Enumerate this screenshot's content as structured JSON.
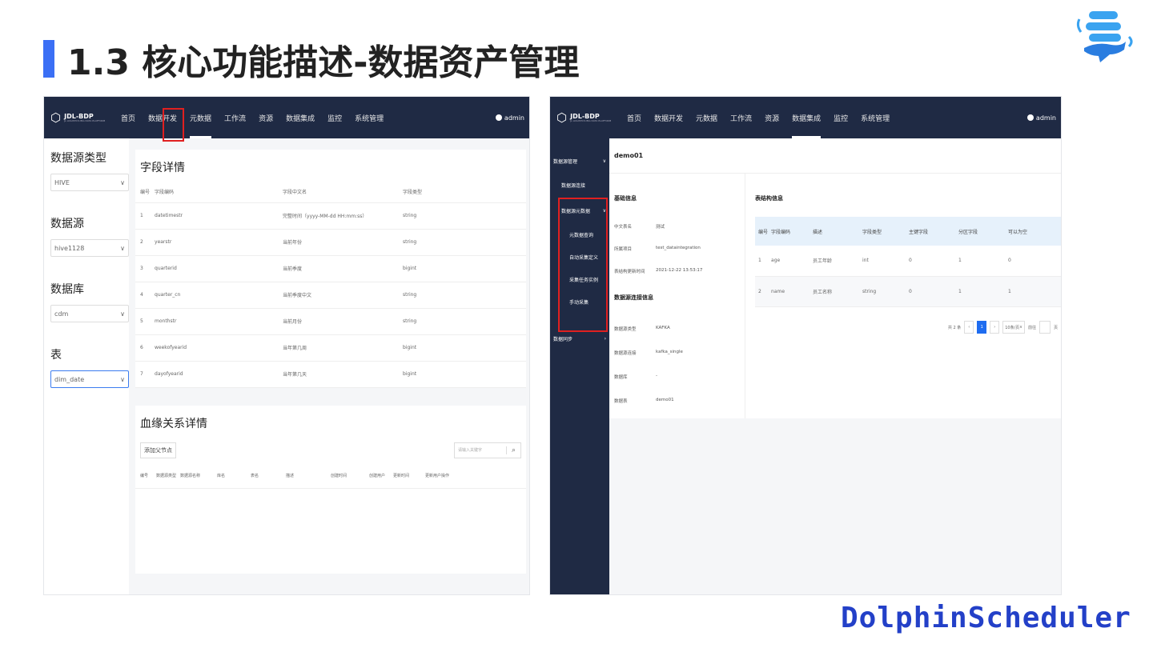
{
  "slide": {
    "title": "1.3 核心功能描述-数据资产管理",
    "brand": "DolphinScheduler",
    "accent_color": "#3b6ff5",
    "brand_color": "#2340c8"
  },
  "left_screen": {
    "logo": {
      "name": "JDL-BDP",
      "sub": "JL LOGISTICS BIG DATA PLATFORM"
    },
    "nav": [
      "首页",
      "数据开发",
      "元数据",
      "工作流",
      "资源",
      "数据集成",
      "监控",
      "系统管理"
    ],
    "active_nav": "元数据",
    "user": "admin",
    "filters": [
      {
        "label": "数据源类型",
        "value": "HIVE"
      },
      {
        "label": "数据源",
        "value": "hive1128"
      },
      {
        "label": "数据库",
        "value": "cdm"
      },
      {
        "label": "表",
        "value": "dim_date"
      }
    ],
    "field_detail": {
      "title": "字段详情",
      "columns": [
        "编号",
        "字段编码",
        "字段中文名",
        "字段类型"
      ],
      "rows": [
        [
          "1",
          "datetimestr",
          "完整时间（yyyy-MM-dd HH:mm:ss）",
          "string"
        ],
        [
          "2",
          "yearstr",
          "当前年份",
          "string"
        ],
        [
          "3",
          "quarterid",
          "当前季度",
          "bigint"
        ],
        [
          "4",
          "quarter_cn",
          "当前季度中文",
          "string"
        ],
        [
          "5",
          "monthstr",
          "当前月份",
          "string"
        ],
        [
          "6",
          "weekofyearid",
          "当年第几周",
          "bigint"
        ],
        [
          "7",
          "dayofyearid",
          "当年第几天",
          "bigint"
        ]
      ]
    },
    "lineage": {
      "title": "血缘关系详情",
      "add_button": "添加父节点",
      "search_placeholder": "请输入关键字",
      "columns": [
        "编号",
        "数据源类型",
        "数据源名称",
        "库名",
        "表名",
        "描述",
        "创建时间",
        "创建用户",
        "更新时间",
        "更新用户",
        "操作"
      ]
    }
  },
  "right_screen": {
    "logo": {
      "name": "JDL-BDP",
      "sub": "JL LOGISTICS BIG DATA PLATFORM"
    },
    "nav": [
      "首页",
      "数据开发",
      "元数据",
      "工作流",
      "资源",
      "数据集成",
      "监控",
      "系统管理"
    ],
    "active_nav": "数据集成",
    "user": "admin",
    "sidebar": {
      "group1": "数据源管理",
      "item1": "数据源连接",
      "group2": "数据源元数据",
      "subitems": [
        "元数据查询",
        "自动采集定义",
        "采集任务实例",
        "手动采集"
      ],
      "group3": "数据同步"
    },
    "tab_title": "demo01",
    "basic_info": {
      "title": "基础信息",
      "fields": [
        {
          "k": "中文表名",
          "v": "测试"
        },
        {
          "k": "所属项目",
          "v": "test_dataintegration"
        },
        {
          "k": "表结构更新时间",
          "v": "2021-12-22 13:53:17"
        }
      ]
    },
    "conn_info": {
      "title": "数据源连接信息",
      "fields": [
        {
          "k": "数据源类型",
          "v": "KAFKA"
        },
        {
          "k": "数据源连接",
          "v": "kafka_single"
        },
        {
          "k": "数据库",
          "v": "-"
        },
        {
          "k": "数据表",
          "v": "demo01"
        }
      ]
    },
    "structure": {
      "title": "表结构信息",
      "columns": [
        "编号",
        "字段编码",
        "描述",
        "字段类型",
        "主键字段",
        "分区字段",
        "可以为空"
      ],
      "rows": [
        [
          "1",
          "age",
          "员工年龄",
          "int",
          "0",
          "1",
          "0"
        ],
        [
          "2",
          "name",
          "员工名称",
          "string",
          "0",
          "1",
          "1"
        ]
      ]
    },
    "pager": {
      "total": "共 2 条",
      "current": "1",
      "size": "10条/页",
      "goto": "前往",
      "unit": "页"
    }
  }
}
